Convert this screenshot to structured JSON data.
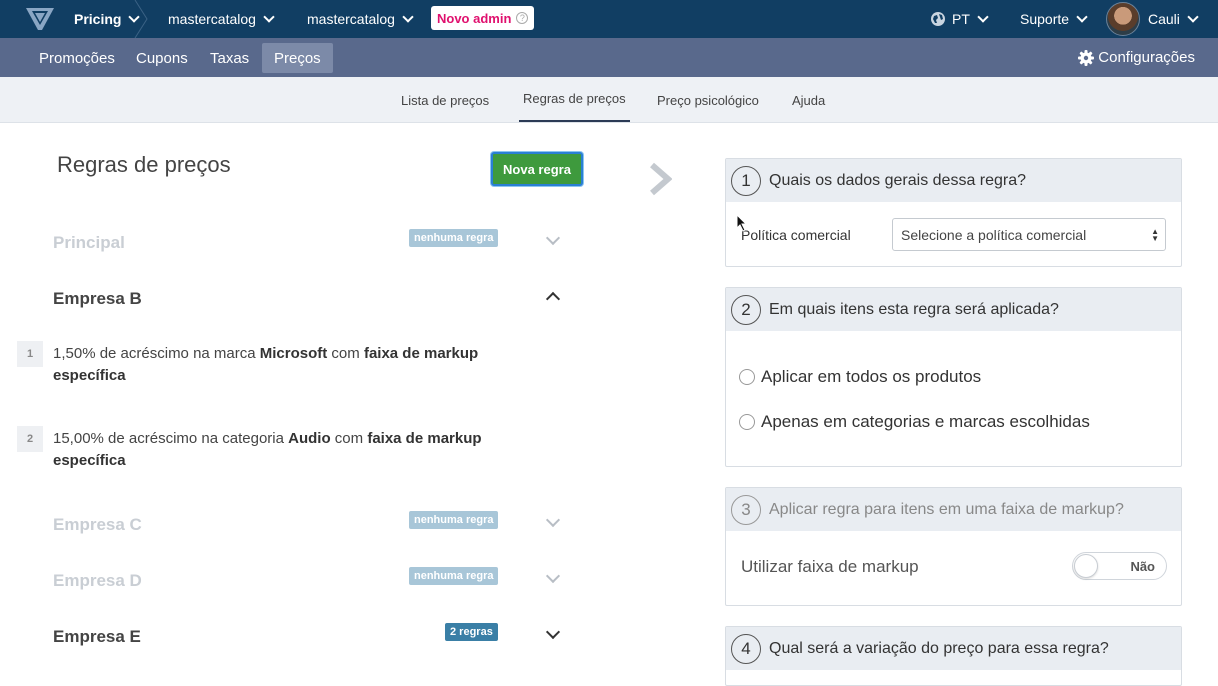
{
  "topbar": {
    "app_menu": "Pricing",
    "crumb1": "mastercatalog",
    "crumb2": "mastercatalog",
    "admin_badge": "Novo admin",
    "admin_help": "?",
    "language": "PT",
    "support": "Suporte",
    "user": "Cauli"
  },
  "navbar": {
    "items": [
      {
        "label": "Promoções"
      },
      {
        "label": "Cupons"
      },
      {
        "label": "Taxas"
      },
      {
        "label": "Preços"
      }
    ],
    "active_index": 3,
    "settings": "Configurações"
  },
  "subnav": {
    "items": [
      {
        "label": "Lista de preços"
      },
      {
        "label": "Regras de preços"
      },
      {
        "label": "Preço psicológico"
      },
      {
        "label": "Ajuda"
      }
    ],
    "active_index": 1
  },
  "left": {
    "title": "Regras de preços",
    "new_button": "Nova regra",
    "groups": [
      {
        "name": "Principal",
        "badge": "nenhuma regra",
        "state": "collapsed"
      },
      {
        "name": "Empresa B",
        "badge": "",
        "state": "expanded"
      },
      {
        "name": "Empresa C",
        "badge": "nenhuma regra",
        "state": "collapsed"
      },
      {
        "name": "Empresa D",
        "badge": "nenhuma regra",
        "state": "collapsed"
      },
      {
        "name": "Empresa E",
        "badge": "2 regras",
        "state": "collapsed"
      }
    ],
    "rules": [
      {
        "num": "1",
        "pre": "1,50% de acréscimo na marca ",
        "target": "Microsoft",
        "mid": " com ",
        "post": "faixa de markup específica"
      },
      {
        "num": "2",
        "pre": "15,00% de acréscimo na categoria ",
        "target": "Audio",
        "mid": " com ",
        "post": "faixa de markup específica"
      }
    ]
  },
  "right": {
    "step1": {
      "num": "1",
      "title": "Quais os dados gerais dessa regra?",
      "label": "Política comercial",
      "select": "Selecione a política comercial"
    },
    "step2": {
      "num": "2",
      "title": "Em quais itens esta regra será aplicada?",
      "opt1": "Aplicar em todos os produtos",
      "opt2": "Apenas em categorias e marcas escolhidas"
    },
    "step3": {
      "num": "3",
      "title": "Aplicar regra para itens em uma faixa de markup?",
      "label": "Utilizar faixa de markup",
      "toggle": "Não"
    },
    "step4": {
      "num": "4",
      "title": "Qual será a variação do preço para essa regra?"
    }
  },
  "colors": {
    "topbar": "#113e63",
    "navbar": "#59698c",
    "accent_green": "#3e9a3d",
    "admin_pink": "#e0106e"
  }
}
